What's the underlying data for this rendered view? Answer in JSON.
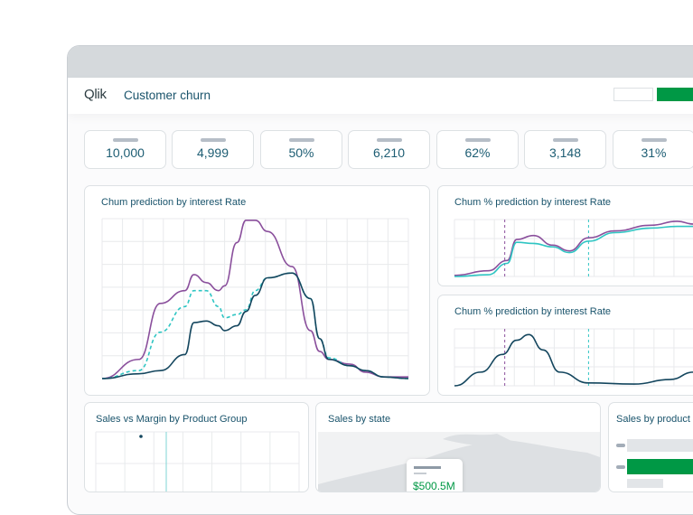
{
  "app": {
    "logo": "Qlik",
    "title": "Customer churn"
  },
  "kpis": [
    "10,000",
    "4,999",
    "50%",
    "6,210",
    "62%",
    "3,148",
    "31%"
  ],
  "colors": {
    "purple": "#8a4f9c",
    "teal": "#2fc5c3",
    "navy": "#14465e",
    "green": "#009845"
  },
  "chart_data": [
    {
      "type": "line",
      "title": "Chum prediction by interest Rate",
      "grid": true,
      "x": [
        0,
        12,
        19,
        27,
        30,
        34,
        38,
        40,
        44,
        47,
        50,
        54,
        62,
        68,
        71,
        74,
        81,
        86,
        92,
        100
      ],
      "series": [
        {
          "values": [
            0,
            12,
            47,
            55,
            65,
            60,
            55,
            58,
            85,
            99,
            99,
            92,
            70,
            30,
            17,
            12,
            9,
            4,
            1,
            1
          ],
          "color": "#8a4f9c",
          "style": "solid"
        },
        {
          "values": [
            0,
            5,
            29,
            45,
            55,
            55,
            45,
            38,
            40,
            43,
            55,
            63,
            66,
            50,
            25,
            13,
            8,
            5,
            1,
            0
          ],
          "color": "#2fc5c3",
          "style": "dashed"
        },
        {
          "values": [
            0,
            3,
            5,
            15,
            35,
            36,
            33,
            30,
            33,
            42,
            52,
            63,
            66,
            50,
            25,
            12,
            8,
            5,
            1,
            0
          ],
          "color": "#14465e",
          "style": "solid"
        }
      ]
    },
    {
      "type": "line",
      "title": "Chum % prediction by interest Rate",
      "grid": true,
      "x": [
        0,
        14,
        22,
        26,
        33,
        41,
        48,
        56,
        67,
        82,
        93,
        100
      ],
      "series": [
        {
          "values": [
            2,
            10,
            28,
            65,
            72,
            55,
            45,
            68,
            80,
            90,
            97,
            92
          ],
          "color": "#8a4f9c",
          "style": "solid"
        },
        {
          "values": [
            0,
            3,
            23,
            60,
            58,
            52,
            42,
            62,
            77,
            85,
            88,
            88
          ],
          "color": "#2fc5c3",
          "style": "solid"
        }
      ],
      "markers": [
        {
          "x": 21,
          "color": "#8a4f9c"
        },
        {
          "x": 56,
          "color": "#2fc5c3"
        }
      ]
    },
    {
      "type": "line",
      "title": "Chum % prediction by interest Rate",
      "grid": true,
      "x": [
        0,
        11,
        20,
        26,
        31,
        37,
        44,
        56,
        75,
        90,
        100
      ],
      "series": [
        {
          "values": [
            0,
            24,
            55,
            80,
            90,
            63,
            24,
            5,
            3,
            11,
            24
          ],
          "color": "#14465e",
          "style": "solid"
        }
      ],
      "markers": [
        {
          "x": 21,
          "color": "#8a4f9c"
        },
        {
          "x": 56,
          "color": "#2fc5c3"
        }
      ]
    }
  ],
  "bottom": {
    "scatter_title": "Sales vs Margin by Product Group",
    "map_title": "Sales by state",
    "map_tooltip": "$500.5M",
    "bar_title": "Sales by product"
  }
}
